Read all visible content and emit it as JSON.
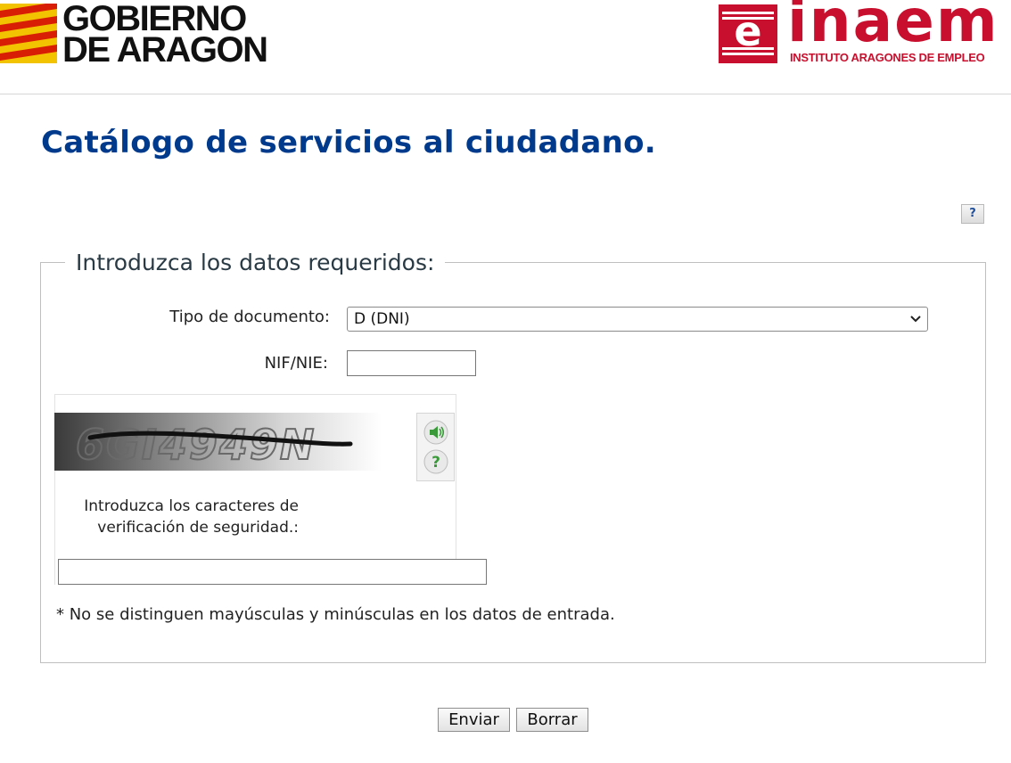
{
  "header": {
    "gobierno_line1": "GOBIERNO",
    "gobierno_line2": "DE ARAGON",
    "inaem_word": "inaem",
    "inaem_subtitle": "INSTITUTO ARAGONES DE EMPLEO",
    "brand_red": "#c8102e",
    "flag_yellow": "#f2c300"
  },
  "page": {
    "title": "Catálogo de servicios al ciudadano.",
    "title_color": "#003a8c",
    "help_label": "?"
  },
  "form": {
    "legend": "Introduzca los datos requeridos:",
    "doc_type_label": "Tipo de documento:",
    "doc_type_value": "D (DNI)",
    "nif_label": "NIF/NIE:",
    "nif_value": "",
    "captcha_text": "6GI4949N",
    "captcha_label": "Introduzca los caracteres de verificación de seguridad.:",
    "captcha_value": "",
    "note": "* No se distinguen mayúsculas y minúsculas en los datos de entrada.",
    "captcha_icons": [
      "speaker-icon",
      "question-icon"
    ]
  },
  "actions": {
    "submit": "Enviar",
    "reset": "Borrar"
  }
}
